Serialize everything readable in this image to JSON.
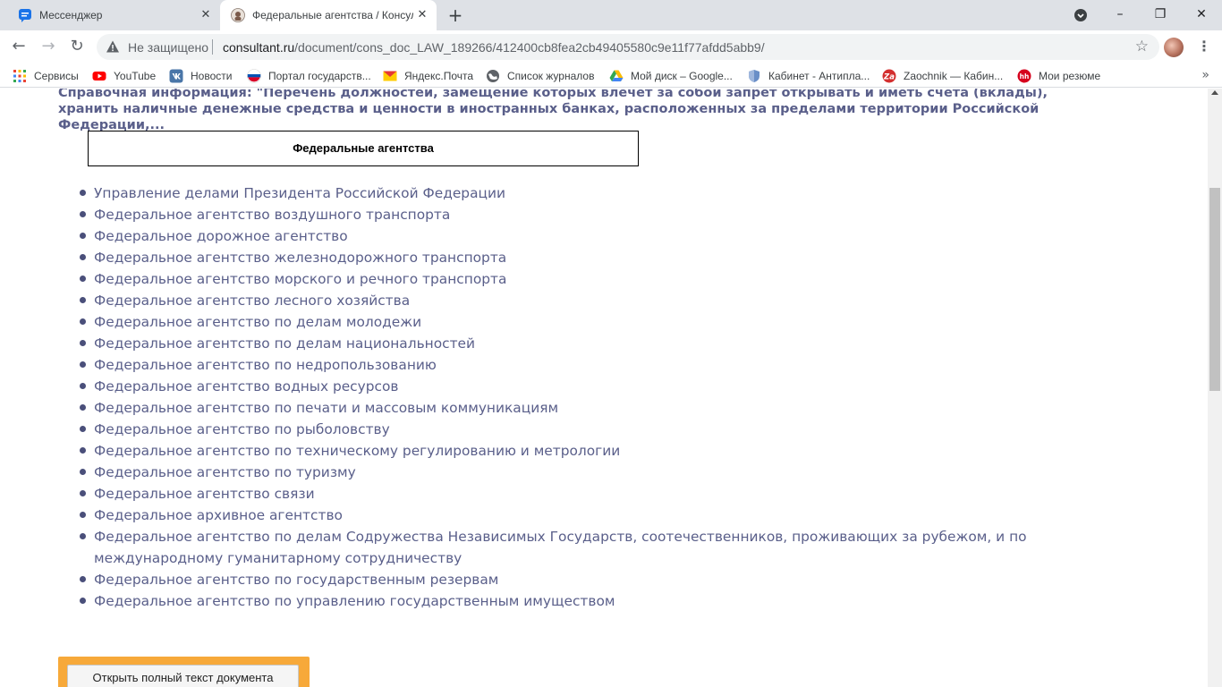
{
  "browser": {
    "tabs": [
      {
        "title": "Мессенджер",
        "icon": "chat-bubble-icon",
        "close": "✕"
      },
      {
        "title": "Федеральные агентства / Консультант",
        "icon": "site-logo-icon",
        "close": "✕",
        "active": true
      }
    ],
    "new_tab_symbol": "+",
    "window_controls": {
      "minimize": "–",
      "maximize": "❐",
      "close": "✕"
    },
    "address_bar": {
      "security_label": "Не защищено",
      "url_domain": "consultant.ru",
      "url_path": "/document/cons_doc_LAW_189266/412400cb8fea2cb49405580c9e11f77afdd5abb9/"
    },
    "nav": {
      "back": "←",
      "forward": "→",
      "reload": "↻"
    },
    "star_symbol": "☆",
    "menu_symbol": "⋮",
    "bookmarks": [
      {
        "label": "Сервисы",
        "icon": "apps-grid-icon"
      },
      {
        "label": "YouTube",
        "icon": "youtube-icon"
      },
      {
        "label": "Новости",
        "icon": "vk-icon"
      },
      {
        "label": "Портал государств...",
        "icon": "russia-flag-icon"
      },
      {
        "label": "Яндекс.Почта",
        "icon": "mail-icon"
      },
      {
        "label": "Список журналов",
        "icon": "globe-icon"
      },
      {
        "label": "Мой диск – Google...",
        "icon": "google-drive-icon"
      },
      {
        "label": "Кабинет - Антипла...",
        "icon": "shield-icon"
      },
      {
        "label": "Zaochnik — Кабин...",
        "icon": "zaochnik-icon"
      },
      {
        "label": "Мои резюме",
        "icon": "hh-icon"
      }
    ],
    "bookmarks_more": "»"
  },
  "colors": {
    "text_link": "#5a5f8a",
    "orange": "#f7a93a",
    "tabstrip": "#dee1e6"
  },
  "page": {
    "reference_title": "Справочная информация: \"Перечень должностей, замещение которых влечет за собой запрет открывать и иметь счета (вклады), хранить наличные денежные средства и ценности в иностранных банках, расположенных за пределами территории Российской Федерации,...",
    "box_heading": "Федеральные агентства",
    "agencies": [
      "Управление делами Президента Российской Федерации",
      "Федеральное агентство воздушного транспорта",
      "Федеральное дорожное агентство",
      "Федеральное агентство железнодорожного транспорта",
      "Федеральное агентство морского и речного транспорта",
      "Федеральное агентство лесного хозяйства",
      "Федеральное агентство по делам молодежи",
      "Федеральное агентство по делам национальностей",
      "Федеральное агентство по недропользованию",
      "Федеральное агентство водных ресурсов",
      "Федеральное агентство по печати и массовым коммуникациям",
      "Федеральное агентство по рыболовству",
      "Федеральное агентство по техническому регулированию и метрологии",
      "Федеральное агентство по туризму",
      "Федеральное агентство связи",
      "Федеральное архивное агентство",
      "Федеральное агентство по делам Содружества Независимых Государств, соотечественников, проживающих за рубежом, и по международному гуманитарному сотрудничеству",
      "Федеральное агентство по государственным резервам",
      "Федеральное агентство по управлению государственным имуществом"
    ],
    "open_full_text_button": "Открыть полный текст документа"
  }
}
